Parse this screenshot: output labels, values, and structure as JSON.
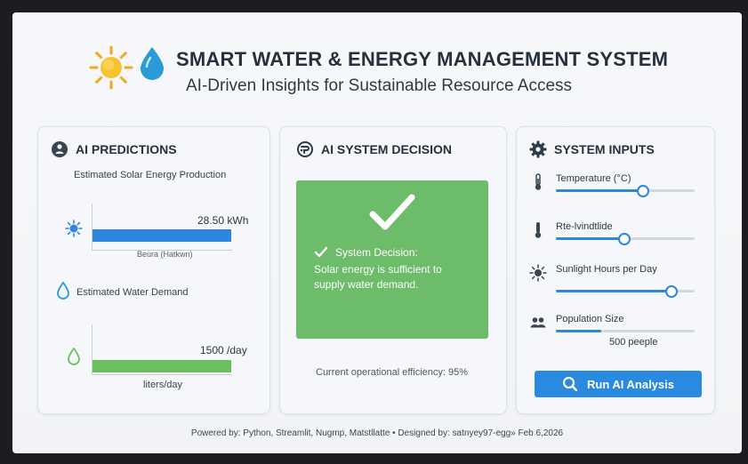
{
  "header": {
    "title": "SMART WATER & ENERGY MANAGEMENT SYSTEM",
    "subtitle": "AI-Driven Insights for Sustainable Resource Access"
  },
  "predictions": {
    "heading": "AI PREDICTIONS",
    "solar": {
      "label": "Estimated Solar Energy Production",
      "value": "28.50 kWh",
      "axis_label": "Beura (Hatkwn)",
      "fill_fraction": 1.0
    },
    "water": {
      "label": "Estimated Water Demand",
      "value": "1500 /day",
      "axis_label": "liters/day",
      "fill_fraction": 1.0
    }
  },
  "decision": {
    "heading": "AI SYSTEM DECISION",
    "decision_title": "System Decision:",
    "decision_message_1": "Solar energy is sufficient to",
    "decision_message_2": "supply water demand.",
    "efficiency": "Current operational efficiency: 95%"
  },
  "inputs": {
    "heading": "SYSTEM INPUTS",
    "items": [
      {
        "label": "Temperature (°C)",
        "icon": "thermometer-icon",
        "slider_fraction": 0.62
      },
      {
        "label": "Rte-lvindtlide",
        "icon": "thermometer-icon",
        "slider_fraction": 0.49
      },
      {
        "label": "Sunlight Hours per Day",
        "icon": "sun-icon",
        "slider_fraction": 0.83
      },
      {
        "label": "Population Size",
        "icon": "people-icon",
        "slider_fraction": 0.33
      }
    ],
    "population_value": "500 peeple",
    "run_button": "Run AI Analysis"
  },
  "footer": {
    "text": "Powered by: Python, Streamlit, Nugmp, Matstllatte • Designed by: satnyey97-egg» Feb 6,2026"
  },
  "colors": {
    "accent_blue": "#2e86de",
    "success_green": "#6cbc6a",
    "bar_green": "#6cbf5e",
    "sun_yellow": "#f6b52a",
    "drop_blue": "#2a9bd6"
  }
}
